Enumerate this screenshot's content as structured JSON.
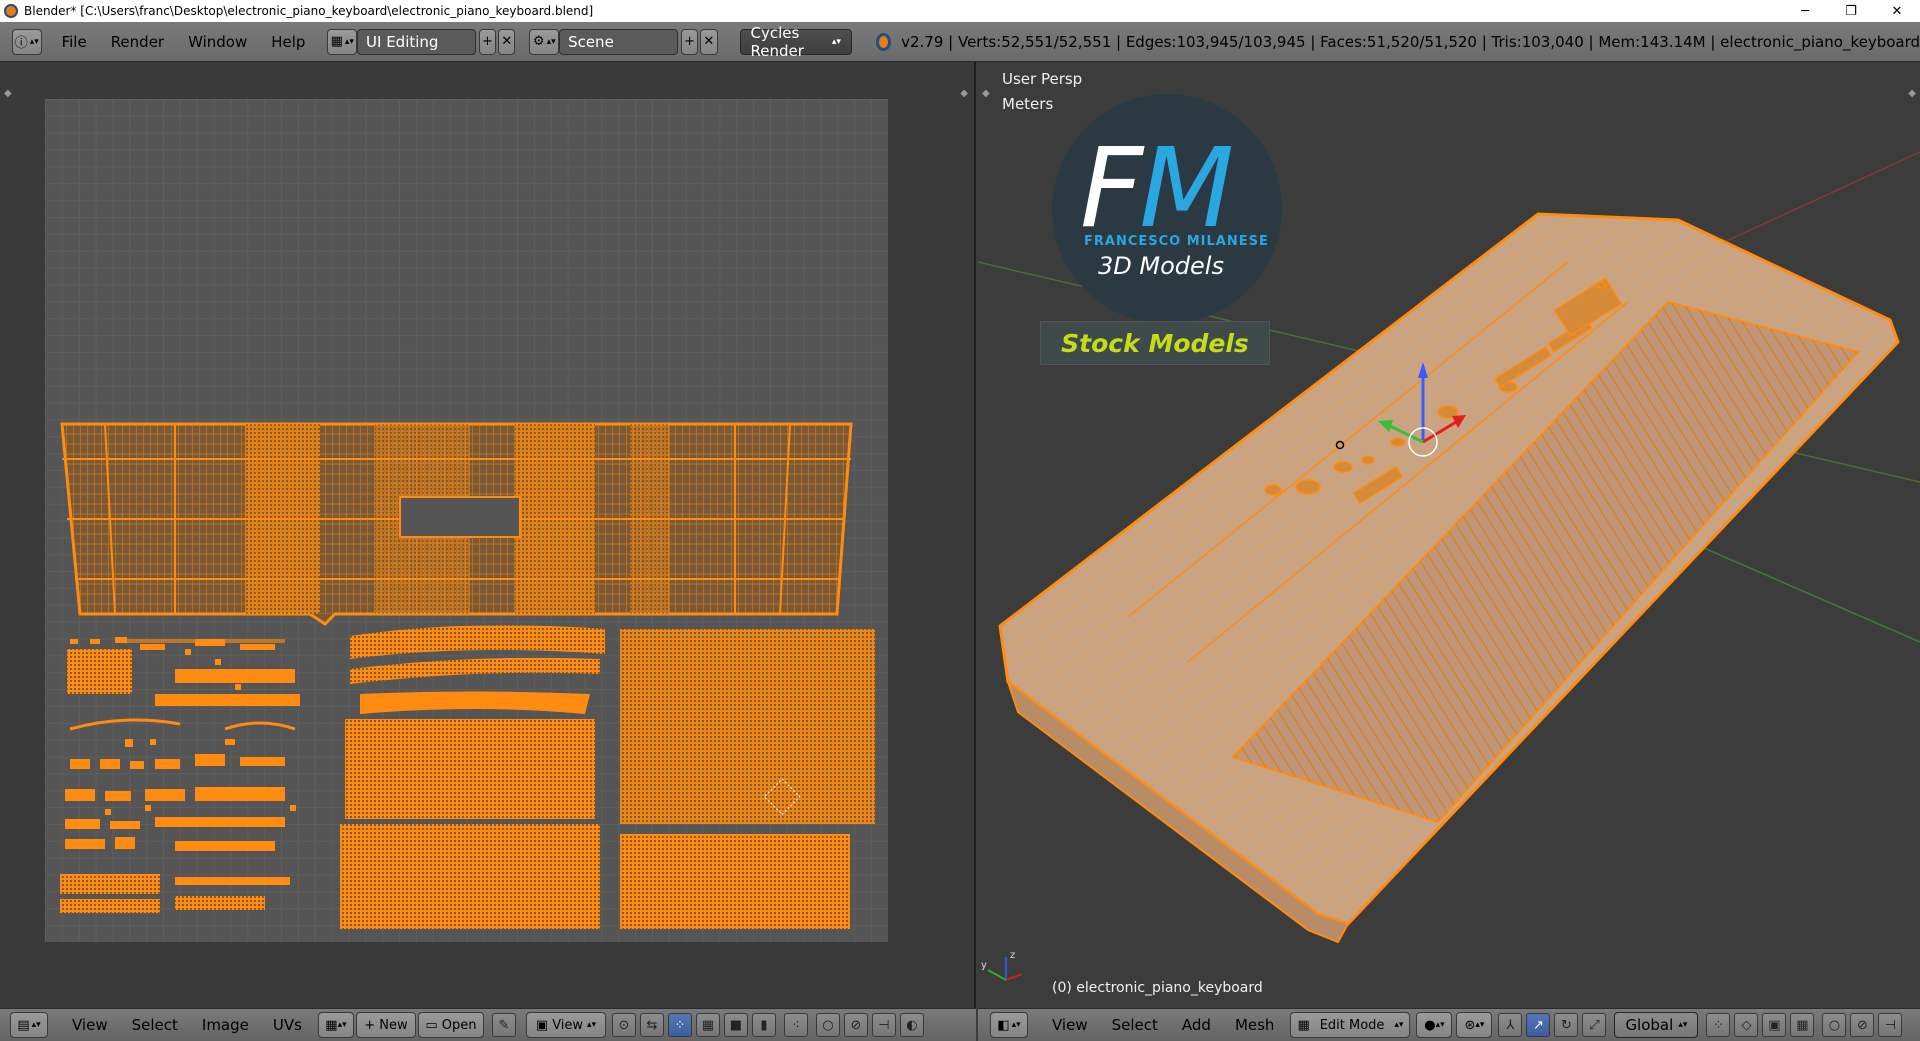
{
  "window": {
    "title": "Blender* [C:\\Users\\franc\\Desktop\\electronic_piano_keyboard\\electronic_piano_keyboard.blend]",
    "minimize": "─",
    "restore": "❐",
    "close": "✕"
  },
  "info_header": {
    "menus": [
      "File",
      "Render",
      "Window",
      "Help"
    ],
    "screen_layout": "UI Editing",
    "scene": "Scene",
    "render_engine": "Cycles Render",
    "stats": "v2.79 | Verts:52,551/52,551 | Edges:103,945/103,945 | Faces:51,520/51,520 | Tris:103,040 | Mem:143.14M | electronic_piano_keyboard"
  },
  "viewport": {
    "view_name": "User Persp",
    "units": "Meters",
    "object_label": "(0) electronic_piano_keyboard",
    "logo": {
      "letters_f": "F",
      "letters_m": "M",
      "name": "FRANCESCO MILANESE",
      "subtitle": "3D Models",
      "badge": "Stock Models"
    }
  },
  "uv_header": {
    "menus": [
      "View",
      "Select",
      "Image",
      "UVs"
    ],
    "new_label": "New",
    "open_label": "Open",
    "view_label": "View"
  },
  "view3d_header": {
    "menus": [
      "View",
      "Select",
      "Add",
      "Mesh"
    ],
    "mode": "Edit Mode",
    "orientation": "Global"
  },
  "colors": {
    "accent_orange": "#ff8c10",
    "uv_face_fill": "#7a5a36",
    "mesh_fill": "#c9a484",
    "logo_blue": "#2aa6e0",
    "badge_green": "#c6dc1a"
  }
}
